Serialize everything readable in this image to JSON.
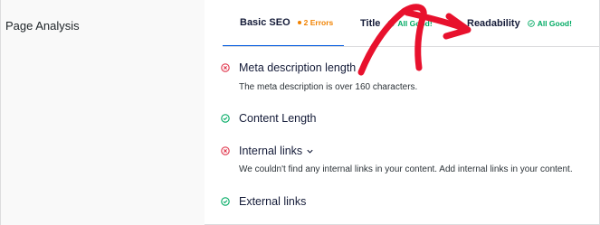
{
  "section": {
    "title": "Page Analysis"
  },
  "tabs": [
    {
      "label": "Basic SEO",
      "badge": "2 Errors",
      "badge_type": "warning",
      "active": true
    },
    {
      "label": "Title",
      "badge": "All Good!",
      "badge_type": "good",
      "active": false
    },
    {
      "label": "Readability",
      "badge": "All Good!",
      "badge_type": "good",
      "active": false
    }
  ],
  "items": [
    {
      "title": "Meta description length",
      "status": "error",
      "description": "The meta description is over 160 characters.",
      "expandable": false
    },
    {
      "title": "Content Length",
      "status": "good",
      "description": "",
      "expandable": false
    },
    {
      "title": "Internal links",
      "status": "error",
      "description": "We couldn't find any internal links in your content. Add internal links in your content.",
      "expandable": true
    },
    {
      "title": "External links",
      "status": "good",
      "description": "",
      "expandable": false
    }
  ],
  "colors": {
    "error": "#e0364c",
    "good": "#00aa63",
    "warning": "#f18200",
    "active_tab": "#005ae0",
    "annotation_arrow": "#e8112d"
  },
  "icons": {
    "error": "x-circle-icon",
    "good": "check-circle-icon",
    "chevron": "chevron-down-icon"
  }
}
